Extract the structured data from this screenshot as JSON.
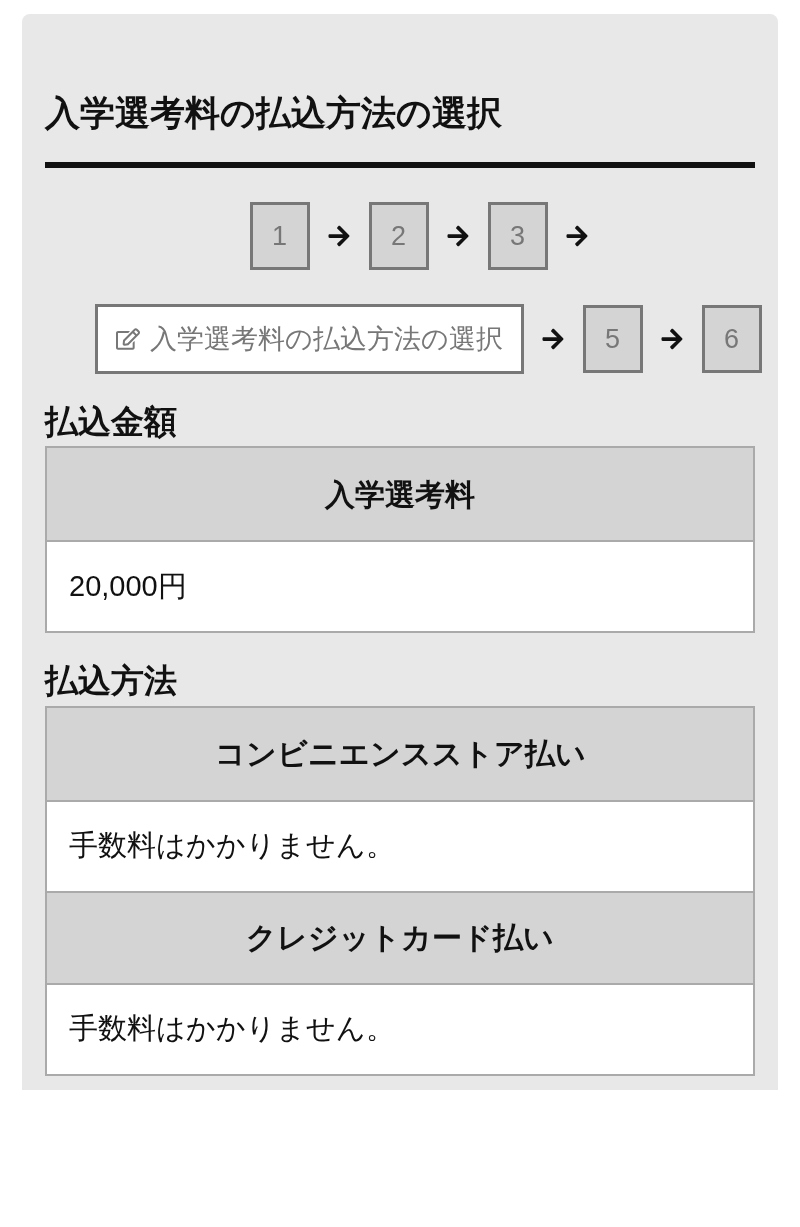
{
  "title": "入学選考料の払込方法の選択",
  "steps": [
    {
      "label": "1",
      "selected": false
    },
    {
      "label": "2",
      "selected": false
    },
    {
      "label": "3",
      "selected": false
    },
    {
      "label": "入学選考料の払込方法の選択",
      "selected": true
    },
    {
      "label": "5",
      "selected": false
    },
    {
      "label": "6",
      "selected": false
    }
  ],
  "sections": [
    {
      "heading": "払込金額",
      "rows": [
        {
          "kind": "header",
          "text": "入学選考料"
        },
        {
          "kind": "body",
          "text": "20,000円"
        }
      ]
    },
    {
      "heading": "払込方法",
      "rows": [
        {
          "kind": "header",
          "text": "コンビニエンスストア払い"
        },
        {
          "kind": "body",
          "text": "手数料はかかりません。"
        },
        {
          "kind": "header",
          "text": "クレジットカード払い"
        },
        {
          "kind": "body",
          "text": "手数料はかかりません。"
        }
      ]
    }
  ]
}
